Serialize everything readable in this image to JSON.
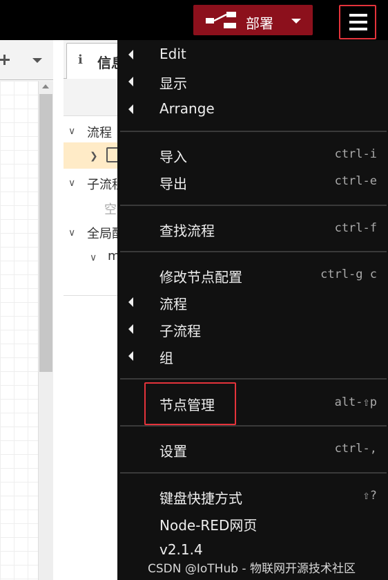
{
  "header": {
    "deploy_label": "部署",
    "accent_color": "#8c101c",
    "highlight_color": "#e5333b"
  },
  "sidebar": {
    "tab_label": "信息",
    "tree": [
      {
        "label": "流程"
      },
      {
        "label": "子流程"
      },
      {
        "label": "空"
      },
      {
        "label": "全局配置"
      },
      {
        "label": "m"
      }
    ]
  },
  "menu": {
    "items": [
      {
        "label": "Edit",
        "shortcut": "",
        "submenu": true
      },
      {
        "label": "显示",
        "shortcut": "",
        "submenu": true
      },
      {
        "label": "Arrange",
        "shortcut": "",
        "submenu": true
      },
      {
        "label": "导入",
        "shortcut": "ctrl-i",
        "submenu": false
      },
      {
        "label": "导出",
        "shortcut": "ctrl-e",
        "submenu": false
      },
      {
        "label": "查找流程",
        "shortcut": "ctrl-f",
        "submenu": false
      },
      {
        "label": "修改节点配置",
        "shortcut": "ctrl-g c",
        "submenu": false
      },
      {
        "label": "流程",
        "shortcut": "",
        "submenu": true
      },
      {
        "label": "子流程",
        "shortcut": "",
        "submenu": true
      },
      {
        "label": "组",
        "shortcut": "",
        "submenu": true
      },
      {
        "label": "节点管理",
        "shortcut": "alt-⇧p",
        "submenu": false
      },
      {
        "label": "设置",
        "shortcut": "ctrl-,",
        "submenu": false
      },
      {
        "label": "键盘快捷方式",
        "shortcut": "⇧?",
        "submenu": false
      },
      {
        "label": "Node-RED网页",
        "shortcut": "",
        "submenu": false
      },
      {
        "label": "v2.1.4",
        "shortcut": "",
        "submenu": false
      }
    ]
  },
  "watermark": "CSDN @IoTHub - 物联网开源技术社区"
}
